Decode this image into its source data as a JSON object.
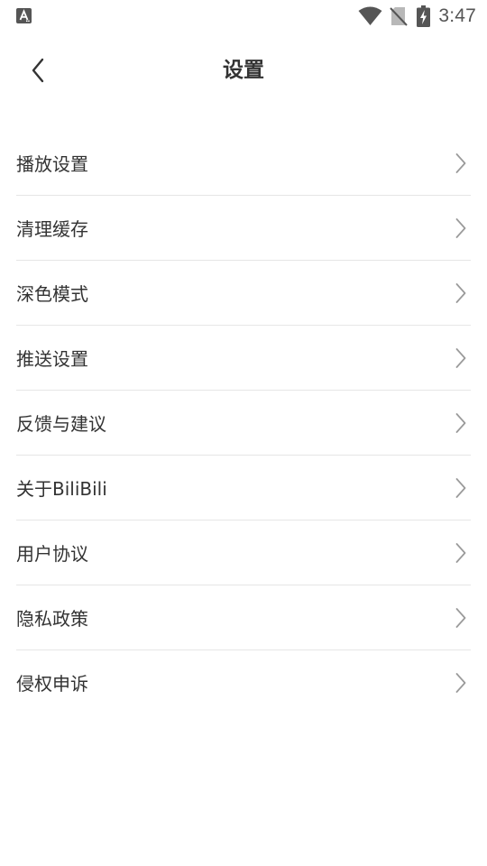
{
  "status_bar": {
    "time": "3:47",
    "left_icon": "a-notification-icon",
    "icons": [
      "wifi-icon",
      "no-sim-icon",
      "battery-charging-icon"
    ]
  },
  "header": {
    "back_icon": "chevron-left-icon",
    "title": "设置"
  },
  "settings": {
    "items": [
      {
        "label": "播放设置"
      },
      {
        "label": "清理缓存"
      },
      {
        "label": "深色模式"
      },
      {
        "label": "推送设置"
      },
      {
        "label": "反馈与建议"
      },
      {
        "label": "关于BiliBili"
      },
      {
        "label": "用户协议"
      },
      {
        "label": "隐私政策"
      },
      {
        "label": "侵权申诉"
      }
    ],
    "item_icon": "chevron-right-icon"
  },
  "colors": {
    "title_text": "#333333",
    "item_text": "#333333",
    "divider": "#e6e6e6",
    "chevron": "#9a9a9a",
    "status_icons": "#555555"
  }
}
